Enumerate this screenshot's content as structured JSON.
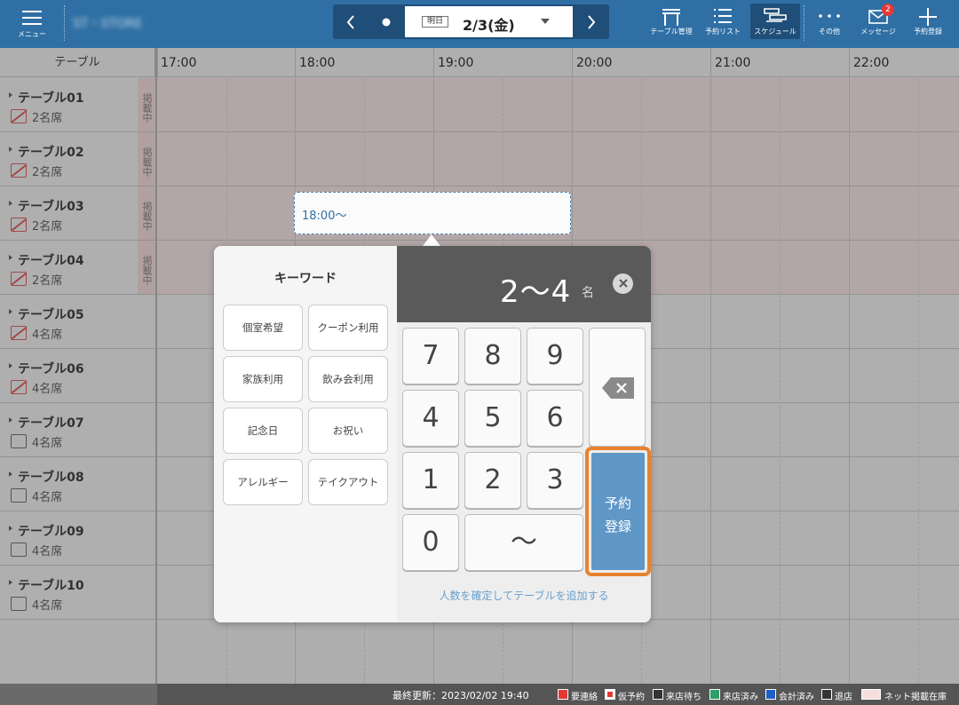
{
  "topbar": {
    "menu_label": "メニュー",
    "shop_name": "ST・STORE",
    "date_tag": "明日",
    "date": "2/3(金)",
    "tools": {
      "table_manage": "テーブル管理",
      "reserve_list": "予約リスト",
      "schedule": "スケジュール",
      "other": "その他",
      "messages": "メッセージ",
      "messages_badge": "2",
      "register": "予約登録"
    }
  },
  "grid": {
    "table_header": "テーブル",
    "hours": [
      "17:00",
      "18:00",
      "19:00",
      "20:00",
      "21:00",
      "22:00"
    ],
    "published_label": "掲載中",
    "tables": [
      {
        "name": "テーブル01",
        "seats": "2名席"
      },
      {
        "name": "テーブル02",
        "seats": "2名席"
      },
      {
        "name": "テーブル03",
        "seats": "2名席"
      },
      {
        "name": "テーブル04",
        "seats": "2名席"
      },
      {
        "name": "テーブル05",
        "seats": "4名席"
      },
      {
        "name": "テーブル06",
        "seats": "4名席"
      },
      {
        "name": "テーブル07",
        "seats": "4名席"
      },
      {
        "name": "テーブル08",
        "seats": "4名席"
      },
      {
        "name": "テーブル09",
        "seats": "4名席"
      },
      {
        "name": "テーブル10",
        "seats": "4名席"
      }
    ]
  },
  "booking": {
    "start": "18:00〜"
  },
  "popup": {
    "keyword_title": "キーワード",
    "keywords": [
      "個室希望",
      "クーポン利用",
      "家族利用",
      "飲み会利用",
      "記念日",
      "お祝い",
      "アレルギー",
      "テイクアウト"
    ],
    "display_value": "2〜4",
    "display_unit": "名",
    "keys": [
      "7",
      "8",
      "9",
      "4",
      "5",
      "6",
      "1",
      "2",
      "3",
      "0",
      "〜"
    ],
    "register_line1": "予約",
    "register_line2": "登録",
    "hint": "人数を確定してテーブルを追加する"
  },
  "footer": {
    "last_updated": "最終更新：2023/02/02 19:40",
    "legend": [
      "要連絡",
      "仮予約",
      "来店待ち",
      "来店済み",
      "会計済み",
      "退店",
      "ネット掲載在庫"
    ],
    "legend_colors": [
      "#e53935",
      "#e53935",
      "#333333",
      "#2e9e6a",
      "#1e5fc9",
      "#333333",
      "#f6dede"
    ]
  }
}
